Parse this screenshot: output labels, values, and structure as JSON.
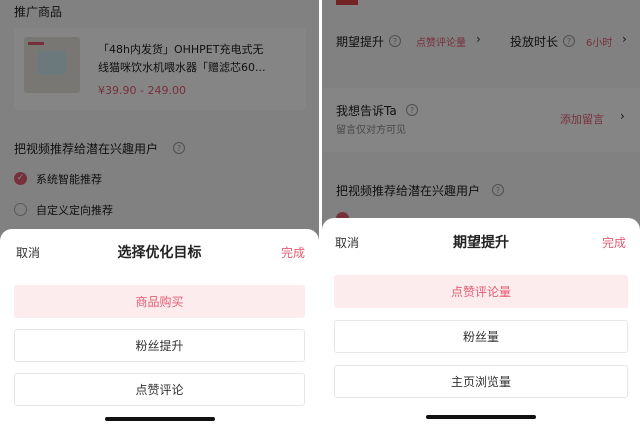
{
  "left": {
    "section_title": "推广商品",
    "product": {
      "title_line1": "「48h内发货」OHHPET充电式无",
      "title_line2": "线猫咪饮水机喂水器「赠滤芯60...",
      "price": "¥39.90 - 249.00"
    },
    "recommend_label": "把视频推荐给潜在兴趣用户",
    "options": [
      {
        "label": "系统智能推荐",
        "selected": true
      },
      {
        "label": "自定义定向推荐",
        "selected": false
      }
    ],
    "sheet": {
      "cancel": "取消",
      "title": "选择优化目标",
      "done": "完成",
      "items": [
        {
          "label": "商品购买",
          "selected": true
        },
        {
          "label": "粉丝提升",
          "selected": false
        },
        {
          "label": "点赞评论",
          "selected": false
        }
      ]
    }
  },
  "right": {
    "expect_label": "期望提升",
    "expect_value": "点赞评论量",
    "duration_label": "投放时长",
    "duration_value": "6小时",
    "tell_label": "我想告诉Ta",
    "tell_sub": "留言仅对方可见",
    "add_message": "添加留言",
    "recommend_label": "把视频推荐给潜在兴趣用户",
    "sheet": {
      "cancel": "取消",
      "title": "期望提升",
      "done": "完成",
      "items": [
        {
          "label": "点赞评论量",
          "selected": true
        },
        {
          "label": "粉丝量",
          "selected": false
        },
        {
          "label": "主页浏览量",
          "selected": false
        }
      ]
    }
  },
  "colors": {
    "accent": "#e35d73",
    "selected_bg": "#fdeced",
    "overlay": "rgba(0,0,0,0.48)"
  },
  "icons": [
    "question-circle-icon",
    "chevron-right-icon",
    "check-circle-icon",
    "radio-empty-icon"
  ]
}
